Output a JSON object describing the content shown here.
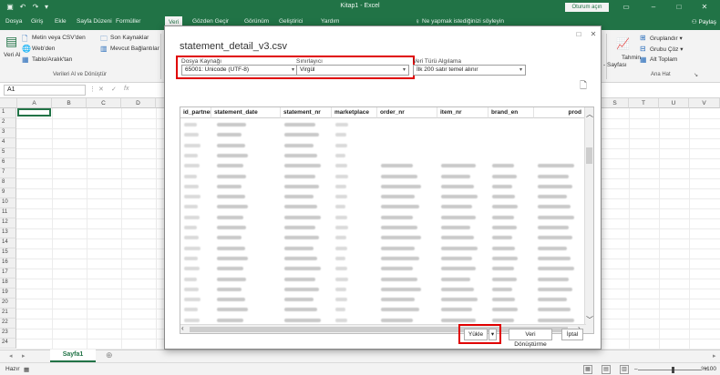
{
  "window": {
    "title": "Kitap1 - Excel",
    "signin": "Oturum açın"
  },
  "menu": {
    "items": [
      "Dosya",
      "Giriş",
      "Ekle",
      "Sayfa Düzeni",
      "Formüller",
      "Veri",
      "Gözden Geçir",
      "Görünüm",
      "Geliştirici",
      "Yardım"
    ],
    "active": "Veri",
    "tell_me": "Ne yapmak istediğinizi söyleyin",
    "share": "Paylaş"
  },
  "ribbon": {
    "get_data": "Veri Al",
    "from_csv": "Metin veya CSV'den",
    "from_web": "Web'den",
    "from_table": "Tablo/Aralık'tan",
    "recent_sources": "Son Kaynaklar",
    "existing_connections": "Mevcut Bağlantılar",
    "group_get_transform": "Verileri Al ve Dönüştür",
    "forecast": "Tahmin",
    "forecast_sheet": "Sayfası",
    "group": "Gruplandır",
    "ungroup": "Grubu Çöz",
    "subtotal": "Alt Toplam",
    "group_outline": "Ana Hat"
  },
  "formula_bar": {
    "name_box": "A1",
    "fx": "fx"
  },
  "grid": {
    "columns_left": [
      "A",
      "B",
      "C",
      "D"
    ],
    "columns_right": [
      "S",
      "T",
      "U",
      "V"
    ],
    "rows": [
      "1",
      "2",
      "3",
      "4",
      "5",
      "6",
      "7",
      "8",
      "9",
      "10",
      "11",
      "12",
      "13",
      "14",
      "15",
      "16",
      "17",
      "18",
      "19",
      "20",
      "21",
      "22",
      "23",
      "24"
    ]
  },
  "sheets": {
    "active": "Sayfa1",
    "add": "⊕"
  },
  "status": {
    "ready": "Hazır",
    "zoom": "%100"
  },
  "dialog": {
    "title": "statement_detail_v3.csv",
    "file_origin_label": "Dosya Kaynağı",
    "file_origin_value": "65001: Unicode (UTF-8)",
    "delimiter_label": "Sınırlayıcı",
    "delimiter_value": "Virgül",
    "type_detection_label": "Veri Türü Algılama",
    "type_detection_value": "İlk 200 satır temel alınır",
    "columns": [
      "id_partner",
      "statement_date",
      "statement_nr",
      "marketplace",
      "order_nr",
      "item_nr",
      "brand_en",
      "prod"
    ],
    "load_button": "Yükle",
    "transform_button": "Veri Dönüştürme",
    "cancel_button": "İptal"
  },
  "colors": {
    "excel_green": "#217346",
    "highlight_red": "#e00000"
  }
}
